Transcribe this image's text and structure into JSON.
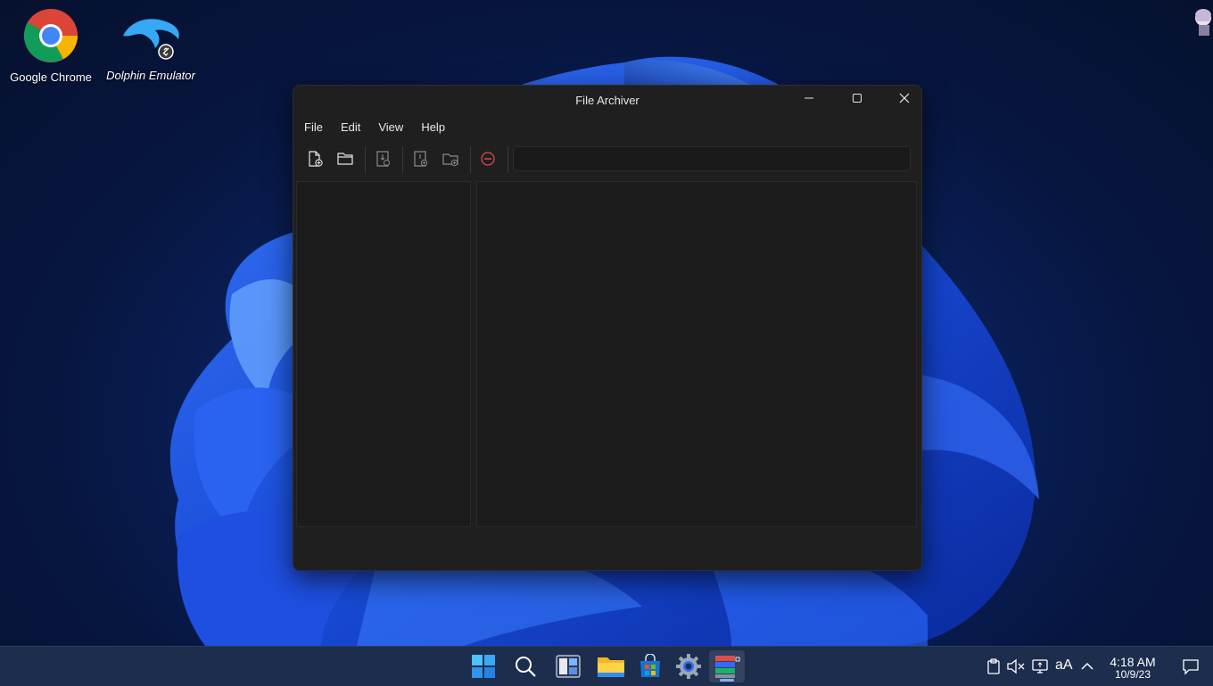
{
  "desktop": {
    "icons": [
      {
        "label": "Google Chrome"
      },
      {
        "label": "Dolphin Emulator"
      }
    ]
  },
  "window": {
    "title": "File Archiver",
    "menu": [
      "File",
      "Edit",
      "View",
      "Help"
    ],
    "toolbar": {
      "buttons": [
        "new-archive-icon",
        "open-folder-icon",
        "extract-icon",
        "add-files-icon",
        "add-folder-icon",
        "remove-icon"
      ],
      "path_value": ""
    }
  },
  "taskbar": {
    "apps": [
      "windows-start-icon",
      "search-icon",
      "widgets-icon",
      "file-explorer-icon",
      "store-icon",
      "settings-icon",
      "file-archiver-icon"
    ],
    "tray": {
      "font_label": "aA",
      "time": "4:18 AM",
      "date": "10/9/23"
    }
  },
  "colors": {
    "window_bg": "#1f1f1f",
    "taskbar_bg": "#1c2d4d",
    "accent": "#2f6cff",
    "remove_red": "#e04b4b"
  }
}
